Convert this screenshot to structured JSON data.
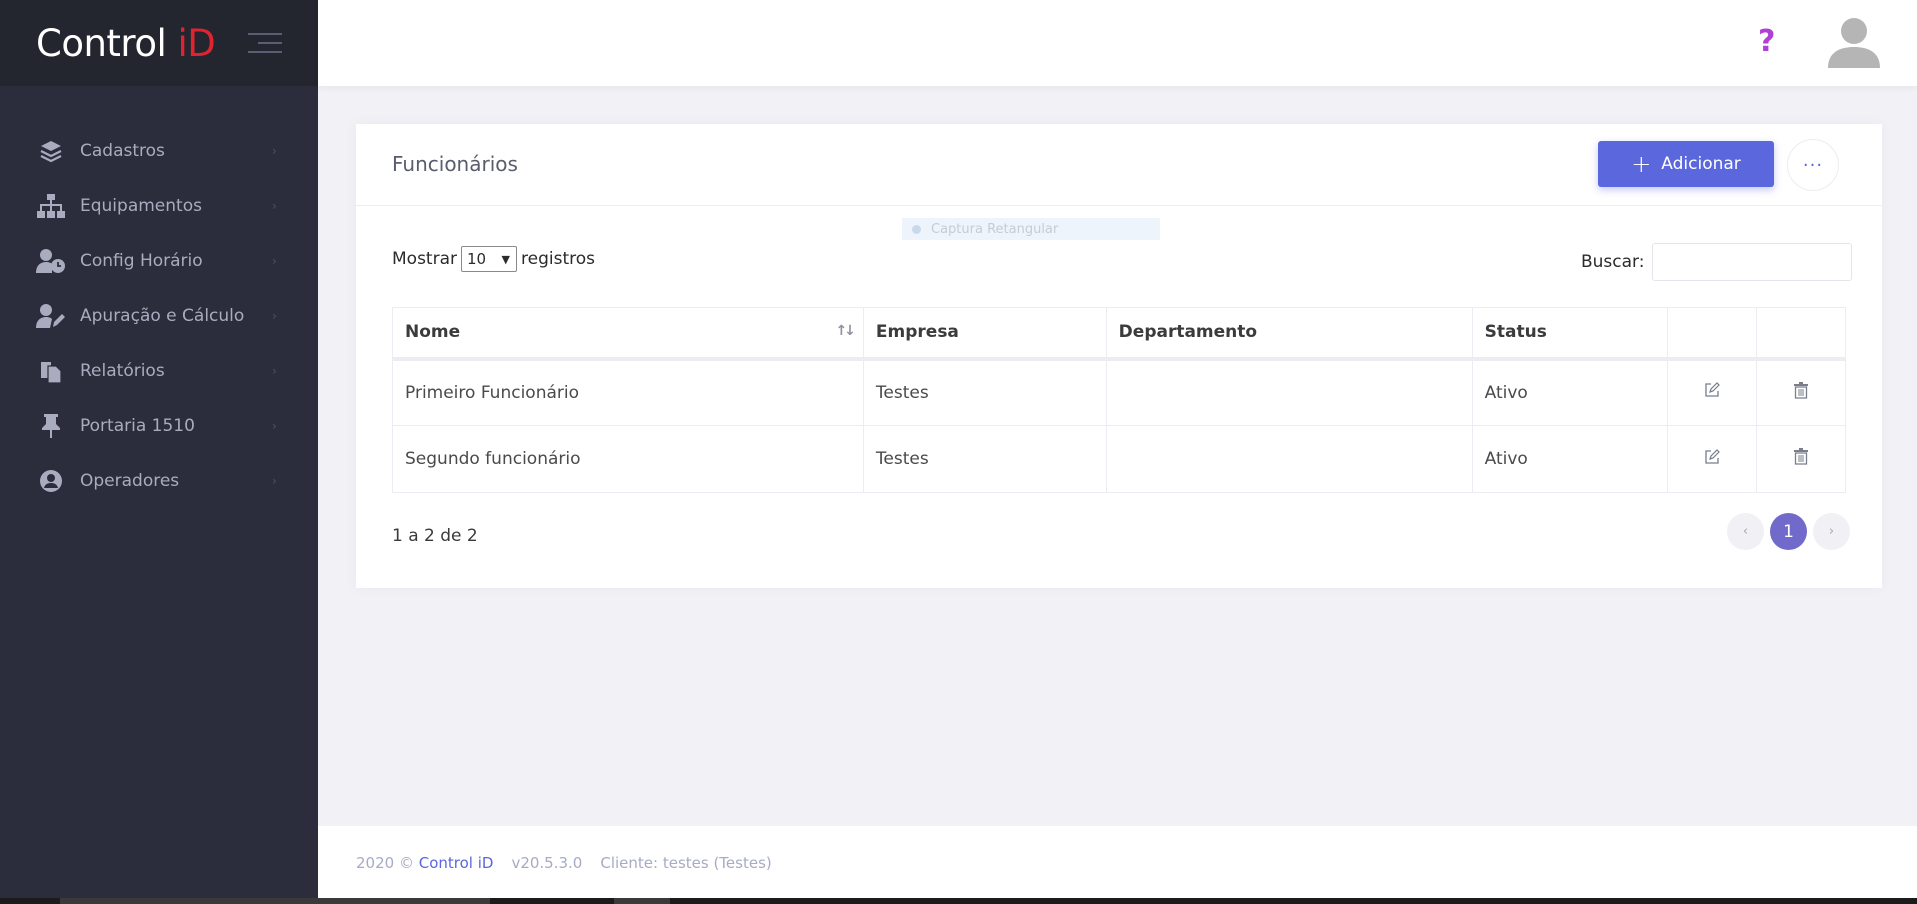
{
  "brand": {
    "name": "Control",
    "suffix": "iD"
  },
  "sidebar": {
    "items": [
      {
        "label": "Cadastros",
        "icon": "layers-icon"
      },
      {
        "label": "Equipamentos",
        "icon": "sitemap-icon"
      },
      {
        "label": "Config Horário",
        "icon": "user-clock-icon"
      },
      {
        "label": "Apuração e Cálculo",
        "icon": "user-edit-icon"
      },
      {
        "label": "Relatórios",
        "icon": "copy-icon"
      },
      {
        "label": "Portaria 1510",
        "icon": "thumbtack-icon"
      },
      {
        "label": "Operadores",
        "icon": "user-circle-icon"
      }
    ]
  },
  "header": {
    "help": "?"
  },
  "page": {
    "title": "Funcionários",
    "add_label": "Adicionar",
    "more_label": "···",
    "overlay_hint": "Captura Retangular"
  },
  "table_controls": {
    "show_prefix": "Mostrar",
    "page_length": "10",
    "show_suffix": "registros",
    "search_label": "Buscar:",
    "search_value": ""
  },
  "table": {
    "columns": [
      "Nome",
      "Empresa",
      "Departamento",
      "Status",
      "",
      ""
    ],
    "rows": [
      {
        "nome": "Primeiro Funcionário",
        "empresa": "Testes",
        "departamento": "",
        "status": "Ativo"
      },
      {
        "nome": "Segundo funcionário",
        "empresa": "Testes",
        "departamento": "",
        "status": "Ativo"
      }
    ]
  },
  "pagination": {
    "info": "1 a 2 de 2",
    "prev": "‹",
    "current": "1",
    "next": "›"
  },
  "footer": {
    "year": "2020 ©",
    "brand": "Control iD",
    "version": "v20.5.3.0",
    "client": "Cliente: testes (Testes)"
  },
  "colors": {
    "accent": "#5a67dd",
    "sidebar_bg": "#2b2d3c",
    "brand_red": "#e1232f",
    "help": "#b13fd6"
  }
}
